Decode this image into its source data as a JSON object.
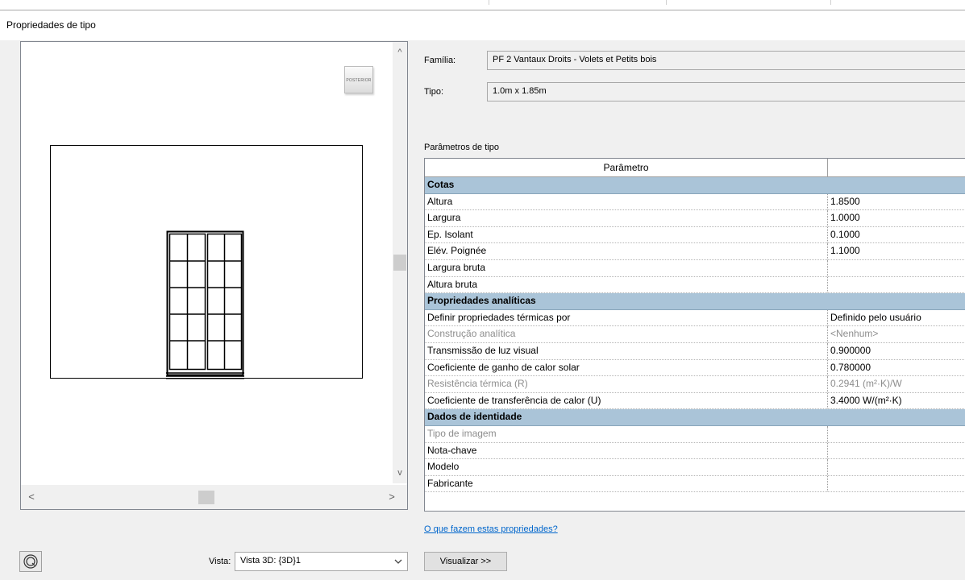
{
  "dialog": {
    "title": "Propriedades de tipo"
  },
  "preview": {
    "viewcube_label": "POSTERIOR",
    "scroll_up": "^",
    "scroll_down": "v",
    "scroll_left": "<",
    "scroll_right": ">"
  },
  "family": {
    "label": "Família:",
    "value": "PF 2 Vantaux Droits - Volets et Petits bois"
  },
  "type": {
    "label": "Tipo:",
    "value": "1.0m x 1.85m"
  },
  "params": {
    "section_label": "Parâmetros de tipo",
    "header": {
      "param": "Parâmetro",
      "value": ""
    },
    "rows": [
      {
        "kind": "group",
        "name": "Cotas"
      },
      {
        "kind": "row",
        "name": "Altura",
        "value": "1.8500"
      },
      {
        "kind": "row",
        "name": "Largura",
        "value": "1.0000"
      },
      {
        "kind": "row",
        "name": "Ep. Isolant",
        "value": "0.1000"
      },
      {
        "kind": "row",
        "name": "Elév. Poignée",
        "value": "1.1000"
      },
      {
        "kind": "row",
        "name": "Largura bruta",
        "value": ""
      },
      {
        "kind": "row",
        "name": "Altura bruta",
        "value": ""
      },
      {
        "kind": "group",
        "name": "Propriedades analíticas"
      },
      {
        "kind": "row",
        "name": "Definir propriedades térmicas por",
        "value": "Definido pelo usuário"
      },
      {
        "kind": "disabled",
        "name": "Construção analítica",
        "value": "<Nenhum>"
      },
      {
        "kind": "row",
        "name": "Transmissão de luz visual",
        "value": "0.900000"
      },
      {
        "kind": "row",
        "name": "Coeficiente de ganho de calor solar",
        "value": "0.780000"
      },
      {
        "kind": "disabled",
        "name": "Resistência térmica (R)",
        "value": "0.2941 (m²·K)/W"
      },
      {
        "kind": "row",
        "name": "Coeficiente de transferência de calor (U)",
        "value": "3.4000 W/(m²·K)"
      },
      {
        "kind": "group",
        "name": "Dados de identidade"
      },
      {
        "kind": "disabled",
        "name": "Tipo de imagem",
        "value": ""
      },
      {
        "kind": "row",
        "name": "Nota-chave",
        "value": ""
      },
      {
        "kind": "row",
        "name": "Modelo",
        "value": ""
      },
      {
        "kind": "row",
        "name": "Fabricante",
        "value": ""
      }
    ]
  },
  "help_link": "O que fazem estas propriedades?",
  "footer": {
    "view_label": "Vista:",
    "view_value": "Vista 3D: {3D}1",
    "preview_button": "Visualizar >>"
  }
}
